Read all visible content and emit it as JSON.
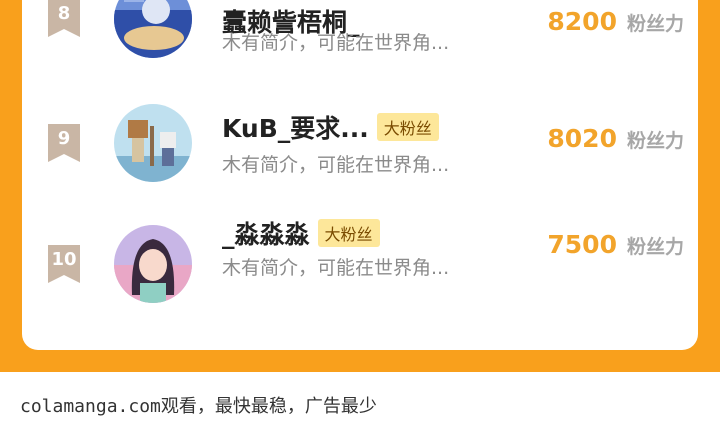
{
  "leaderboard": {
    "rows": [
      {
        "rank": "8",
        "username": "蠹赖訾梧桐_",
        "fan_badge": "",
        "bio": "木有简介，可能在世界角...",
        "score": "8200",
        "score_unit": "粉丝力",
        "avatar_icon": "avatar-blue-ocean"
      },
      {
        "rank": "9",
        "username": "KuB_要求...",
        "fan_badge": "大粉丝",
        "bio": "木有简介，可能在世界角...",
        "score": "8020",
        "score_unit": "粉丝力",
        "avatar_icon": "avatar-block-characters"
      },
      {
        "rank": "10",
        "username": "_淼淼淼",
        "fan_badge": "大粉丝",
        "bio": "木有简介，可能在世界角...",
        "score": "7500",
        "score_unit": "粉丝力",
        "avatar_icon": "avatar-anime-girl"
      }
    ]
  },
  "footer": {
    "text": "colamanga.com观看，最快最稳，广告最少"
  },
  "colors": {
    "accent_orange": "#f9a01c",
    "score_gold": "#f2a42b",
    "badge_yellow": "#fde79a",
    "rank_badge": "#c9b6a5"
  }
}
